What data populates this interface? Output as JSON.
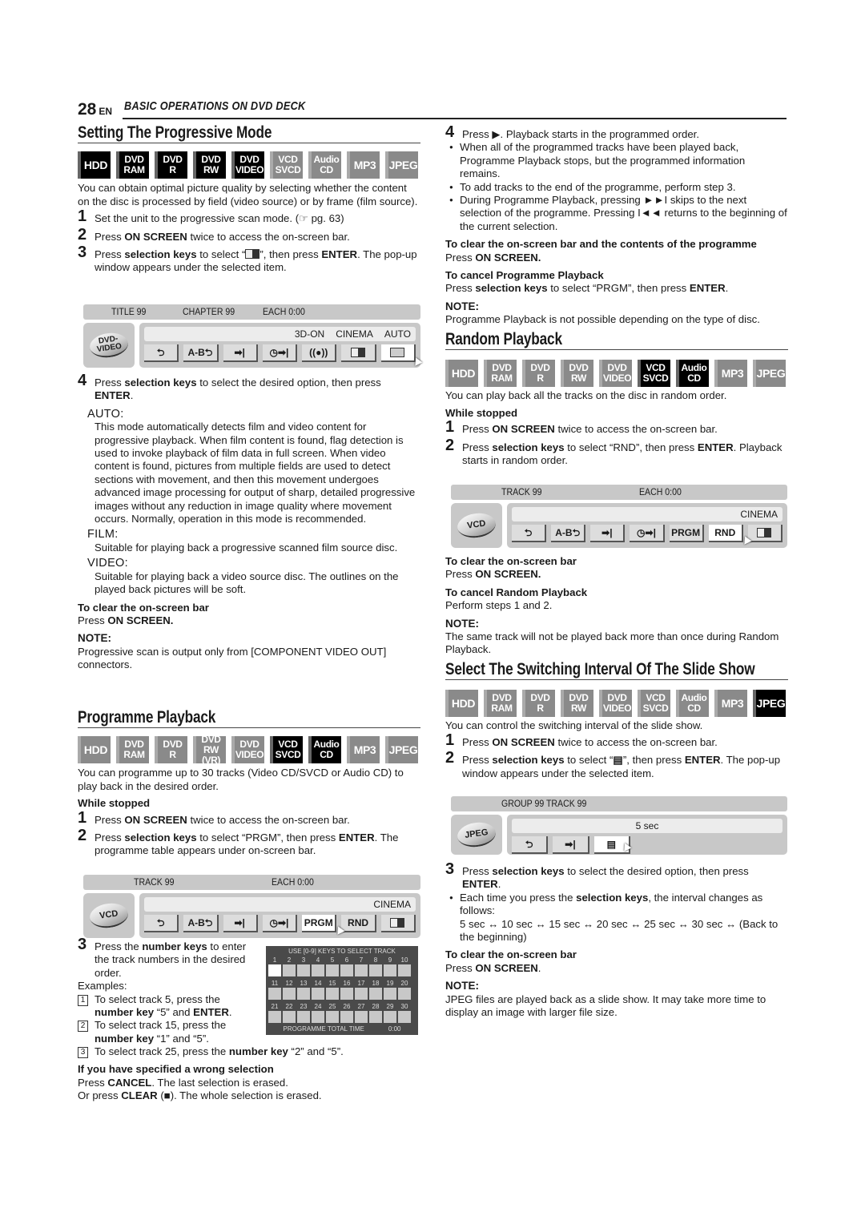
{
  "header": {
    "page_number": "28",
    "lang": "EN",
    "chapter": "BASIC OPERATIONS ON DVD DECK"
  },
  "badge_labels": [
    {
      "l1": "HDD",
      "l2": ""
    },
    {
      "l1": "DVD",
      "l2": "RAM"
    },
    {
      "l1": "DVD",
      "l2": "R"
    },
    {
      "l1": "DVD",
      "l2": "RW"
    },
    {
      "l1": "DVD",
      "l2": "VIDEO"
    },
    {
      "l1": "VCD",
      "l2": "SVCD"
    },
    {
      "l1": "Audio",
      "l2": "CD"
    },
    {
      "l1": "MP3",
      "l2": ""
    },
    {
      "l1": "JPEG",
      "l2": ""
    }
  ],
  "progressive": {
    "title": "Setting The Progressive Mode",
    "active_badges": [
      "HDD",
      "DVD RAM",
      "DVD R",
      "DVD RW",
      "DVD VIDEO"
    ],
    "intro": "You can obtain optimal picture quality by selecting whether the content on the disc is processed by field (video source) or by frame (film source).",
    "step1": "Set the unit to the progressive scan mode. (☞ pg. 63)",
    "step2_pre": "Press ",
    "step2_bold": "ON SCREEN",
    "step2_post": " twice to access the on-screen bar.",
    "step3_pre": "Press ",
    "step3_bold": "selection keys",
    "step3_mid": " to select “",
    "step3_mid2": "”, then press ",
    "step3_bold2": "ENTER",
    "step3_post": ". The pop-up window appears under the selected item.",
    "osd": {
      "top": [
        "TITLE 99",
        "CHAPTER 99",
        "EACH 0:00"
      ],
      "disc": "DVD-\nVIDEO",
      "info": [
        "3D-ON",
        "CINEMA",
        "AUTO"
      ],
      "buttons": [
        "⮌",
        "A-B⮌",
        "➡|",
        "◷➡|",
        "((●))",
        "▣",
        "▣"
      ]
    },
    "step4_pre": "Press ",
    "step4_bold": "selection keys",
    "step4_mid": " to select the desired option, then press ",
    "step4_bold2": "ENTER",
    "step4_post": ".",
    "options": [
      {
        "label": "AUTO:",
        "desc": "This mode automatically detects film and video content for progressive playback. When film content is found, flag detection is used to invoke playback of film data in full screen. When video content is found, pictures from multiple fields are used to detect sections with movement, and then this movement undergoes advanced image processing for output of sharp, detailed progressive images without any reduction in image quality where movement occurs. Normally, operation in this mode is recommended."
      },
      {
        "label": "FILM:",
        "desc": "Suitable for playing back a progressive scanned film source disc."
      },
      {
        "label": "VIDEO:",
        "desc": "Suitable for playing back a video source disc. The outlines on the played back pictures will be soft."
      }
    ],
    "clear_head": "To clear the on-screen bar",
    "clear_pre": "Press ",
    "clear_bold": "ON SCREEN.",
    "note_head": "NOTE:",
    "note": "Progressive scan is output only from [COMPONENT VIDEO OUT] connectors."
  },
  "programme": {
    "title": "Programme Playback",
    "active_badges": [
      "VCD SVCD",
      "Audio CD"
    ],
    "rw_label": "RW (VR)",
    "intro": "You can programme up to 30 tracks (Video CD/SVCD or Audio CD) to play back in the desired order.",
    "while_stopped": "While stopped",
    "step1_pre": "Press ",
    "step1_bold": "ON SCREEN",
    "step1_post": " twice to access the on-screen bar.",
    "step2_pre": "Press ",
    "step2_bold": "selection keys",
    "step2_mid": " to select “PRGM”, then press ",
    "step2_bold2": "ENTER",
    "step2_post": ". The programme table appears under on-screen bar.",
    "osd": {
      "top": [
        "TRACK 99",
        "EACH 0:00"
      ],
      "disc": "VCD",
      "info": [
        "CINEMA"
      ],
      "buttons": [
        "⮌",
        "A-B⮌",
        "➡|",
        "◷➡|",
        "PRGM",
        "RND",
        "▣"
      ]
    },
    "step3_pre": "Press the ",
    "step3_bold": "number keys",
    "step3_post": " to enter the track numbers in the desired order.",
    "examples_label": "Examples:",
    "examples": [
      {
        "n": "1",
        "pre": "To select track 5, press the ",
        "bold": "number key",
        "mid": " “5” and ",
        "bold2": "ENTER",
        "post": "."
      },
      {
        "n": "2",
        "pre": "To select track 15, press the ",
        "bold": "number key",
        "mid": " “1” and “5”.",
        "bold2": "",
        "post": ""
      },
      {
        "n": "3",
        "pre": "To select track 25, press the ",
        "bold": "number key",
        "mid": " “2” and “5”.",
        "bold2": "",
        "post": ""
      }
    ],
    "table": {
      "title": "USE [0-9] KEYS TO SELECT TRACK",
      "rows": [
        [
          1,
          2,
          3,
          4,
          5,
          6,
          7,
          8,
          9,
          10
        ],
        [
          11,
          12,
          13,
          14,
          15,
          16,
          17,
          18,
          19,
          20
        ],
        [
          21,
          22,
          23,
          24,
          25,
          26,
          27,
          28,
          29,
          30
        ]
      ],
      "total_label": "PROGRAMME TOTAL TIME",
      "total_value": "0:00"
    },
    "wrong_head": "If you have specified a wrong selection",
    "wrong1_pre": "Press ",
    "wrong1_bold": "CANCEL",
    "wrong1_post": ". The last selection is erased.",
    "wrong2_pre": "Or press ",
    "wrong2_bold": "CLEAR",
    "wrong2_post": " (■). The whole selection is erased.",
    "step4_pre": "Press ▶. Playback starts in the programmed order.",
    "bullets": [
      "When all of the programmed tracks have been played back, Programme Playback stops, but the programmed information remains.",
      "To add tracks to the end of the programme, perform step 3.",
      "During Programme Playback, pressing ►►I skips to the next selection of the programme. Pressing I◄◄ returns to the beginning of the current selection."
    ],
    "clear_head": "To clear the on-screen bar and the contents of the programme",
    "clear_pre": "Press ",
    "clear_bold": "ON SCREEN.",
    "cancel_head": "To cancel Programme Playback",
    "cancel_pre": "Press ",
    "cancel_bold": "selection keys",
    "cancel_mid": " to select “PRGM”, then press ",
    "cancel_bold2": "ENTER",
    "cancel_post": ".",
    "note_head": "NOTE:",
    "note": "Programme Playback is not possible depending on the type of disc."
  },
  "random": {
    "title": "Random Playback",
    "active_badges": [
      "VCD SVCD",
      "Audio CD"
    ],
    "intro": "You can play back all the tracks on the disc in random order.",
    "while_stopped": "While stopped",
    "step1_pre": "Press ",
    "step1_bold": "ON SCREEN",
    "step1_post": " twice to access the on-screen bar.",
    "step2_pre": "Press ",
    "step2_bold": "selection keys",
    "step2_mid": " to select “RND”, then press ",
    "step2_bold2": "ENTER",
    "step2_post": ". Playback starts in random order.",
    "osd": {
      "top": [
        "TRACK 99",
        "EACH 0:00"
      ],
      "disc": "VCD",
      "info": [
        "CINEMA"
      ],
      "buttons": [
        "⮌",
        "A-B⮌",
        "➡|",
        "◷➡|",
        "PRGM",
        "RND",
        "▣"
      ]
    },
    "clear_head": "To clear the on-screen bar",
    "clear_pre": "Press ",
    "clear_bold": "ON SCREEN.",
    "cancel_head": "To cancel Random Playback",
    "cancel_text": "Perform steps 1 and 2.",
    "note_head": "NOTE:",
    "note": "The same track will not be played back more than once during Random Playback."
  },
  "slideshow": {
    "title": "Select The Switching Interval Of The Slide Show",
    "active_badges": [
      "JPEG"
    ],
    "intro": "You can control the switching interval of the slide show.",
    "step1_pre": "Press ",
    "step1_bold": "ON SCREEN",
    "step1_post": " twice to access the on-screen bar.",
    "step2_pre": "Press ",
    "step2_bold": "selection keys",
    "step2_mid": " to select “",
    "step2_mid2": "”, then press ",
    "step2_bold2": "ENTER",
    "step2_post": ". The pop-up window appears under the selected item.",
    "osd": {
      "top": [
        "GROUP 99  TRACK 99"
      ],
      "disc": "JPEG",
      "info": [
        "5 sec"
      ],
      "buttons": [
        "⮌",
        "➡|",
        "▤"
      ]
    },
    "step3_pre": "Press ",
    "step3_bold": "selection keys",
    "step3_mid": " to select the desired option, then press ",
    "step3_bold2": "ENTER",
    "step3_post": ".",
    "bullet_pre": "Each time you press the ",
    "bullet_bold": "selection keys",
    "bullet_post": ", the interval changes as follows:",
    "sequence": "5 sec ↔ 10 sec ↔ 15 sec ↔ 20 sec ↔ 25 sec ↔ 30 sec ↔ (Back to the beginning)",
    "clear_head": "To clear the on-screen bar",
    "clear_pre": "Press ",
    "clear_bold": "ON SCREEN",
    "clear_post": ".",
    "note_head": "NOTE:",
    "note": "JPEG files are played back as a slide show. It may take more time to display an image with larger file size."
  }
}
